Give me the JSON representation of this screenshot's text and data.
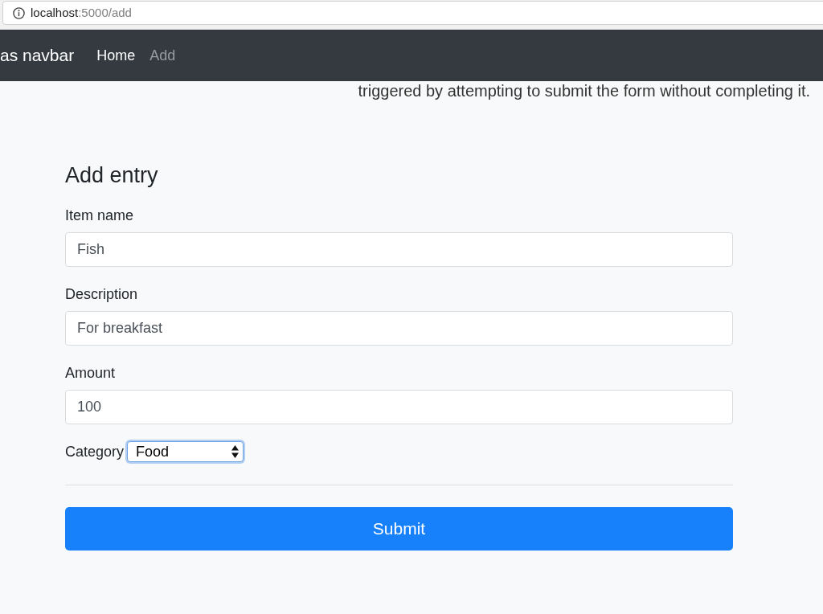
{
  "browser": {
    "url_host": "localhost",
    "url_path": ":5000/add"
  },
  "navbar": {
    "brand": "as navbar",
    "links": [
      {
        "label": "Home",
        "selected": true
      },
      {
        "label": "Add",
        "selected": false
      }
    ]
  },
  "message": "triggered by attempting to submit the form without completing it.",
  "form": {
    "title": "Add entry",
    "fields": [
      {
        "kind": "text",
        "label": "Item name",
        "value": "Fish",
        "focused": false
      },
      {
        "kind": "text",
        "label": "Description",
        "value": "For breakfast",
        "focused": false
      },
      {
        "kind": "text",
        "label": "Amount",
        "value": "100",
        "focused": false
      },
      {
        "kind": "select",
        "label": "Category",
        "value": "Food",
        "focused": true
      }
    ],
    "submit": "Submit"
  }
}
